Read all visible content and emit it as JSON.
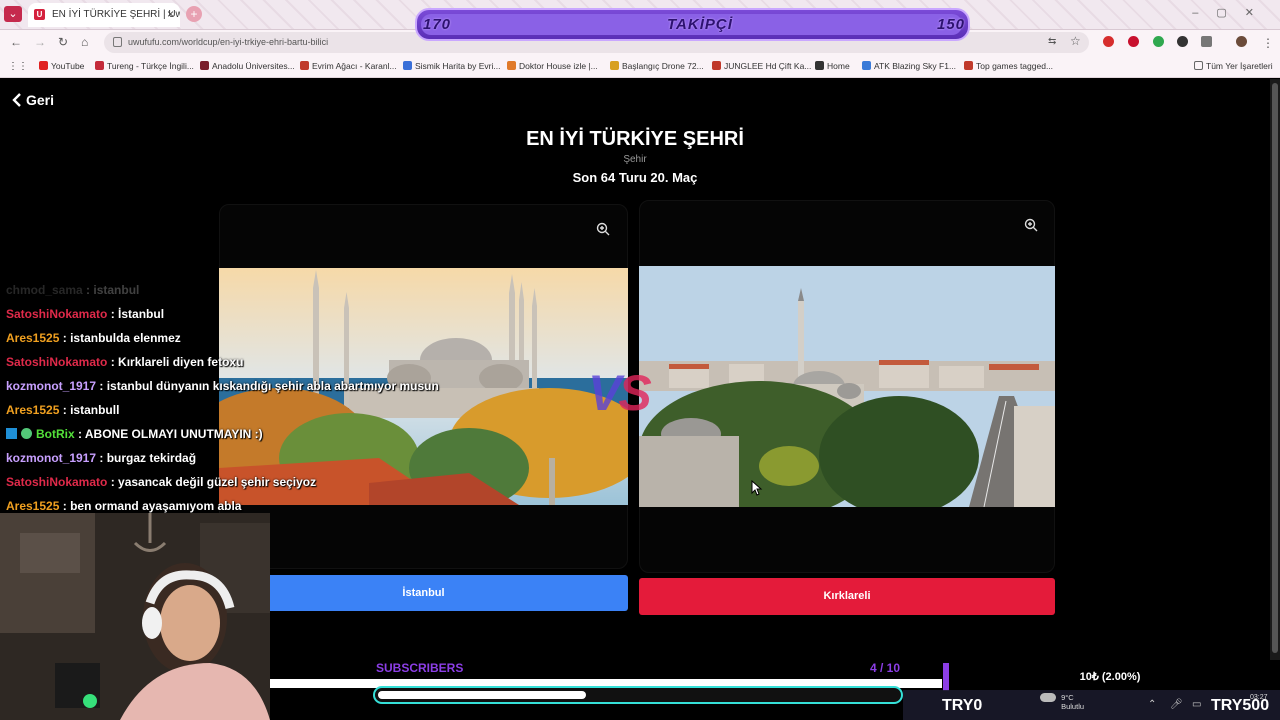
{
  "browser": {
    "tab_title": "EN İYİ TÜRKİYE ŞEHRİ | UwUFU",
    "tab_favicon": "U",
    "url": "uwufufu.com/worldcup/en-iyi-trkiye-ehri-bartu-bilici",
    "bookmarks": [
      {
        "label": "YouTube",
        "color": "#e02020"
      },
      {
        "label": "Tureng - Türkçe İngili...",
        "color": "#c42a3a"
      },
      {
        "label": "Anadolu Üniversites...",
        "color": "#7a1d2b"
      },
      {
        "label": "Evrim Ağacı - Karanl...",
        "color": "#c0392b"
      },
      {
        "label": "Sismik Harita by Evri...",
        "color": "#3a6fd8"
      },
      {
        "label": "Doktor House izle |...",
        "color": "#e07a2a"
      },
      {
        "label": "Başlangıç Drone 72...",
        "color": "#d8a020"
      },
      {
        "label": "JUNGLEE Hd Çift Ka...",
        "color": "#c0392b"
      },
      {
        "label": "Home",
        "color": "#333333"
      },
      {
        "label": "ATK Blazing Sky F1...",
        "color": "#3a7ad8"
      },
      {
        "label": "Top games tagged...",
        "color": "#c0392b"
      }
    ],
    "all_bookmarks": "Tüm Yer İşaretleri"
  },
  "follower_goal": {
    "current": "170",
    "label": "TAKİPÇİ",
    "target": "150"
  },
  "page": {
    "back_label": "Geri",
    "title": "EN İYİ TÜRKİYE ŞEHRİ",
    "category": "Şehir",
    "round": "Son 64 Turu 20. Maç",
    "vs_v": "V",
    "vs_s": "S",
    "left_choice": "İstanbul",
    "right_choice": "Kırklareli"
  },
  "chat": [
    {
      "user": "chmod_sama",
      "user_color": "#9a9a9a",
      "text": "istanbul",
      "faded": true
    },
    {
      "user": "SatoshiNokamato",
      "user_color": "#e02a4a",
      "text": "İstanbul"
    },
    {
      "user": "Ares1525",
      "user_color": "#f0a020",
      "text": "istanbulda elenmez"
    },
    {
      "user": "SatoshiNokamato",
      "user_color": "#e02a4a",
      "text": "Kırklareli diyen fetoxu"
    },
    {
      "user": "kozmonot_1917",
      "user_color": "#c8a0ff",
      "text": "istanbul dünyanın kıskandığı şehir abla abartmıyor musun"
    },
    {
      "user": "Ares1525",
      "user_color": "#f0a020",
      "text": "istanbull"
    },
    {
      "user": "BotRix",
      "user_color": "#53e03a",
      "text": "ABONE OLMAYI UNUTMAYIN :)",
      "badges": true
    },
    {
      "user": "kozmonot_1917",
      "user_color": "#c8a0ff",
      "text": "burgaz tekirdağ"
    },
    {
      "user": "SatoshiNokamato",
      "user_color": "#e02a4a",
      "text": "yasancak değil güzel şehir seçiyoz"
    },
    {
      "user": "Ares1525",
      "user_color": "#f0a020",
      "text": "ben ormand ayaşamıyom abla"
    }
  ],
  "stream": {
    "subscribers_label": "SUBSCRIBERS",
    "subscribers_count": "4 / 10",
    "subscribers_progress": 0.4,
    "donation_goal": "10₺ (2.00%)",
    "donation_min": "TRY0",
    "donation_max": "TRY500"
  },
  "taskbar": {
    "weather_temp": "9°C",
    "weather_desc": "Bulutlu",
    "clock": "03:27"
  },
  "colors": {
    "left_button": "#3b82f6",
    "right_button": "#e41b3a",
    "accent_purple": "#8c3ee6",
    "pill_border": "#35e0d8"
  }
}
